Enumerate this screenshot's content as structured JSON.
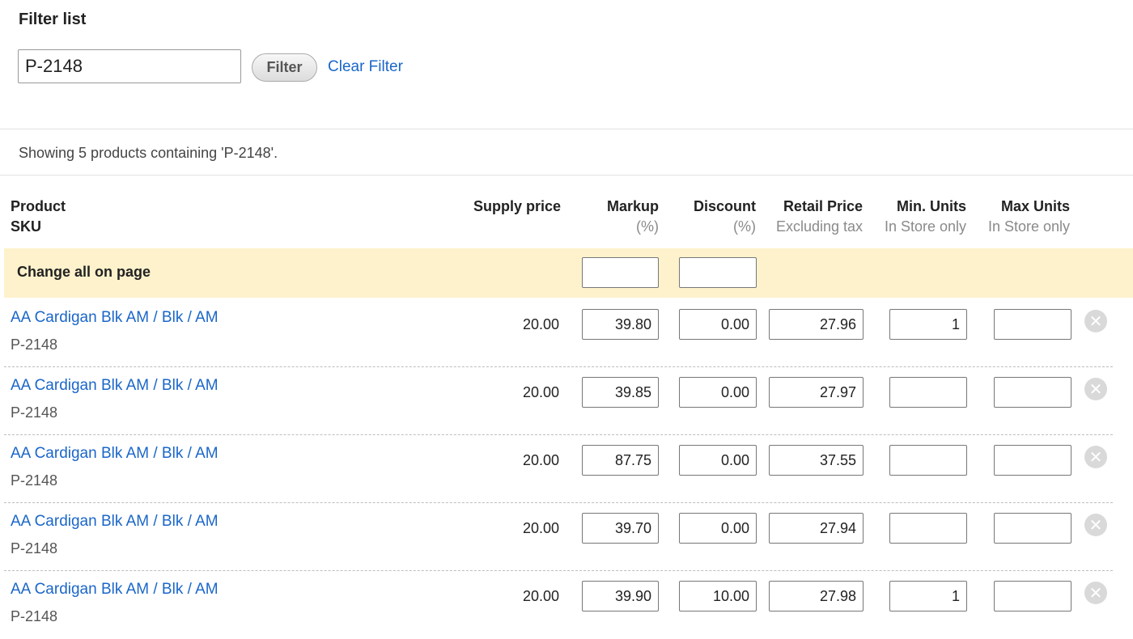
{
  "filter": {
    "title": "Filter list",
    "input_value": "P-2148",
    "filter_button": "Filter",
    "clear_link": "Clear Filter"
  },
  "status_text": "Showing 5 products containing 'P-2148'.",
  "columns": {
    "product": "Product",
    "sku": "SKU",
    "supply_price": "Supply price",
    "markup": "Markup",
    "markup_sub": "(%)",
    "discount": "Discount",
    "discount_sub": "(%)",
    "retail_price": "Retail Price",
    "retail_sub": "Excluding tax",
    "min_units": "Min. Units",
    "min_sub": "In Store only",
    "max_units": "Max Units",
    "max_sub": "In Store only"
  },
  "change_all": {
    "label": "Change all on page",
    "markup": "",
    "discount": ""
  },
  "rows": [
    {
      "name": "AA Cardigan Blk AM / Blk / AM",
      "sku": "P-2148",
      "supply": "20.00",
      "markup": "39.80",
      "discount": "0.00",
      "retail": "27.96",
      "min": "1",
      "max": ""
    },
    {
      "name": "AA Cardigan Blk AM / Blk / AM",
      "sku": "P-2148",
      "supply": "20.00",
      "markup": "39.85",
      "discount": "0.00",
      "retail": "27.97",
      "min": "",
      "max": ""
    },
    {
      "name": "AA Cardigan Blk AM / Blk / AM",
      "sku": "P-2148",
      "supply": "20.00",
      "markup": "87.75",
      "discount": "0.00",
      "retail": "37.55",
      "min": "",
      "max": ""
    },
    {
      "name": "AA Cardigan Blk AM / Blk / AM",
      "sku": "P-2148",
      "supply": "20.00",
      "markup": "39.70",
      "discount": "0.00",
      "retail": "27.94",
      "min": "",
      "max": ""
    },
    {
      "name": "AA Cardigan Blk AM / Blk / AM",
      "sku": "P-2148",
      "supply": "20.00",
      "markup": "39.90",
      "discount": "10.00",
      "retail": "27.98",
      "min": "1",
      "max": ""
    }
  ],
  "icons": {
    "remove": "remove-circle-icon"
  },
  "colors": {
    "link": "#1a66c9",
    "highlight": "#fdf2cc"
  }
}
